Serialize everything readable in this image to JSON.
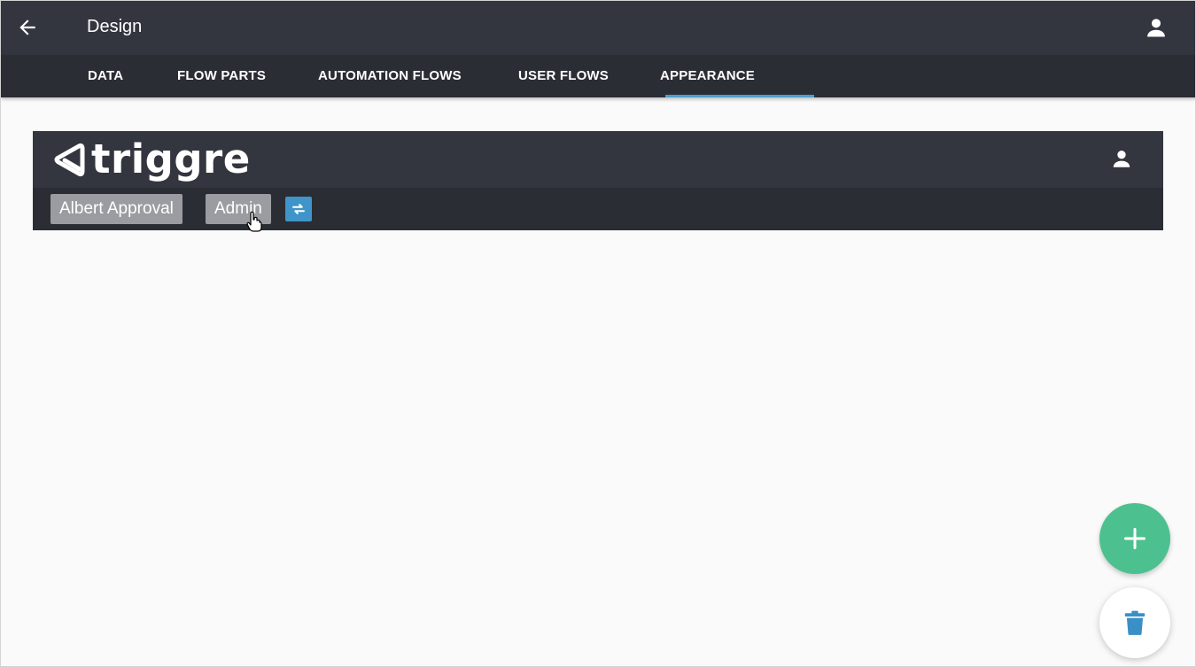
{
  "appbar": {
    "title": "Design",
    "back_icon": "arrow-left-icon",
    "account_icon": "user-icon"
  },
  "tabs": [
    {
      "label": "DATA",
      "active": false
    },
    {
      "label": "FLOW PARTS",
      "active": false
    },
    {
      "label": "AUTOMATION FLOWS",
      "active": false
    },
    {
      "label": "USER FLOWS",
      "active": false
    },
    {
      "label": "APPEARANCE",
      "active": true
    }
  ],
  "preview": {
    "logo_text": "triggre",
    "chips": [
      "Albert Approval",
      "Admin"
    ],
    "swap_icon": "swap-arrows-icon",
    "account_icon": "user-icon"
  },
  "fabs": {
    "add_icon": "plus-icon",
    "delete_icon": "trash-icon"
  },
  "colors": {
    "appbar": "#33363f",
    "tabbar": "#2b2d35",
    "tab_indicator": "#4a9fd0",
    "chip": "#9b9ca1",
    "swap_button": "#3f95c9",
    "add_fab": "#4dc08f",
    "trash_icon": "#3a8fc6",
    "background": "#fafafa"
  }
}
